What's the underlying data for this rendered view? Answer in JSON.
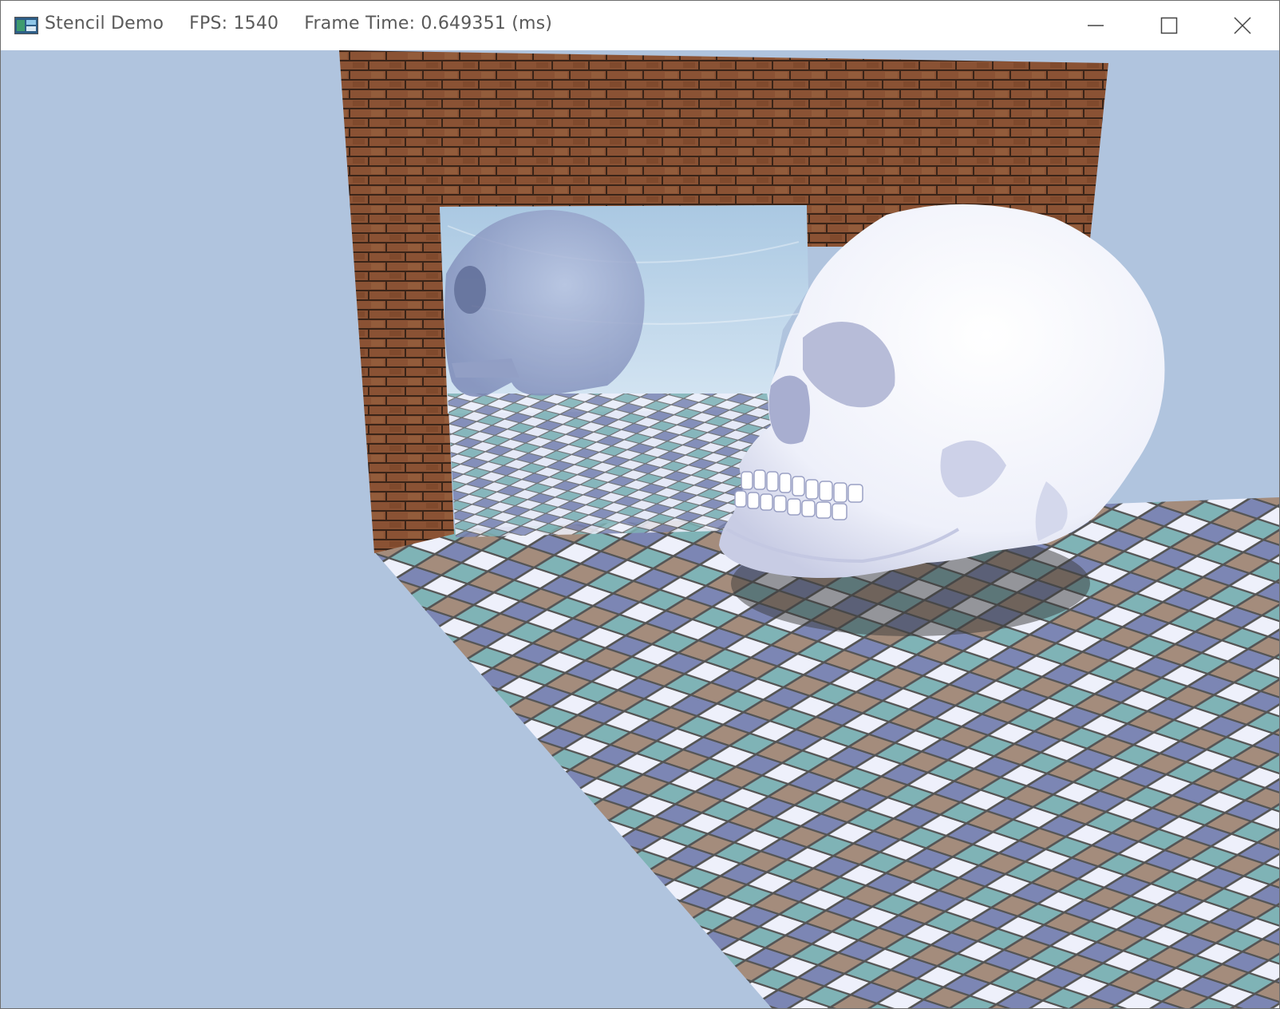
{
  "window": {
    "app_name": "Stencil Demo",
    "fps": "FPS: 1540",
    "frame_time": "Frame Time: 0.649351 (ms)",
    "controls": {
      "minimize": "minimize-icon",
      "maximize": "maximize-icon",
      "close": "close-icon"
    }
  },
  "scene": {
    "clear_color": "#b0c4de",
    "objects": [
      "brick-wall",
      "mirror",
      "reflected-skull",
      "skull",
      "skull-shadow",
      "tiled-floor"
    ],
    "tile_colors": [
      "#eef0fb",
      "#7c86b4",
      "#7fb3b6",
      "#a48c7c"
    ],
    "brick_color": "#8a5234",
    "mortar_color": "#3a2418"
  }
}
